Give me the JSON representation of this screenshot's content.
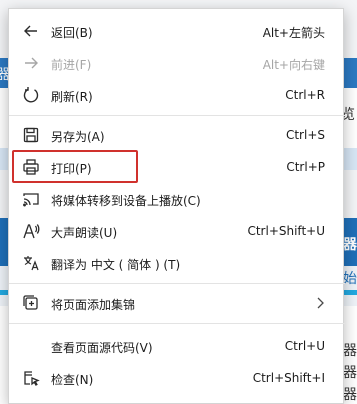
{
  "background": {
    "left_text": "器",
    "right_texts": [
      "浏览",
      "机器",
      "开始",
      "器",
      "器",
      "器"
    ]
  },
  "menu": {
    "items": [
      {
        "label": "返回(B)",
        "shortcut": "Alt+左箭头",
        "icon": "arrow-left-icon",
        "disabled": false
      },
      {
        "label": "前进(F)",
        "shortcut": "Alt+向右键",
        "icon": "arrow-right-icon",
        "disabled": true
      },
      {
        "label": "刷新(R)",
        "shortcut": "Ctrl+R",
        "icon": "refresh-icon",
        "disabled": false
      },
      {
        "label": "另存为(A)",
        "shortcut": "Ctrl+S",
        "icon": "save-icon",
        "disabled": false
      },
      {
        "label": "打印(P)",
        "shortcut": "Ctrl+P",
        "icon": "printer-icon",
        "disabled": false
      },
      {
        "label": "将媒体转移到设备上播放(C)",
        "shortcut": "",
        "icon": "cast-icon",
        "disabled": false
      },
      {
        "label": "大声朗读(U)",
        "shortcut": "Ctrl+Shift+U",
        "icon": "read-aloud-icon",
        "disabled": false
      },
      {
        "label": "翻译为 中文 ( 简体 ) (T)",
        "shortcut": "",
        "icon": "translate-icon",
        "disabled": false
      },
      {
        "label": "将页面添加集锦",
        "shortcut": "",
        "icon": "collections-add-icon",
        "disabled": false
      },
      {
        "label": "查看页面源代码(V)",
        "shortcut": "Ctrl+U",
        "icon": "",
        "disabled": false
      },
      {
        "label": "检查(N)",
        "shortcut": "Ctrl+Shift+I",
        "icon": "inspect-icon",
        "disabled": false
      }
    ]
  },
  "colors": {
    "highlight": "#d0312d",
    "disabled_text": "#a6a6a6"
  }
}
